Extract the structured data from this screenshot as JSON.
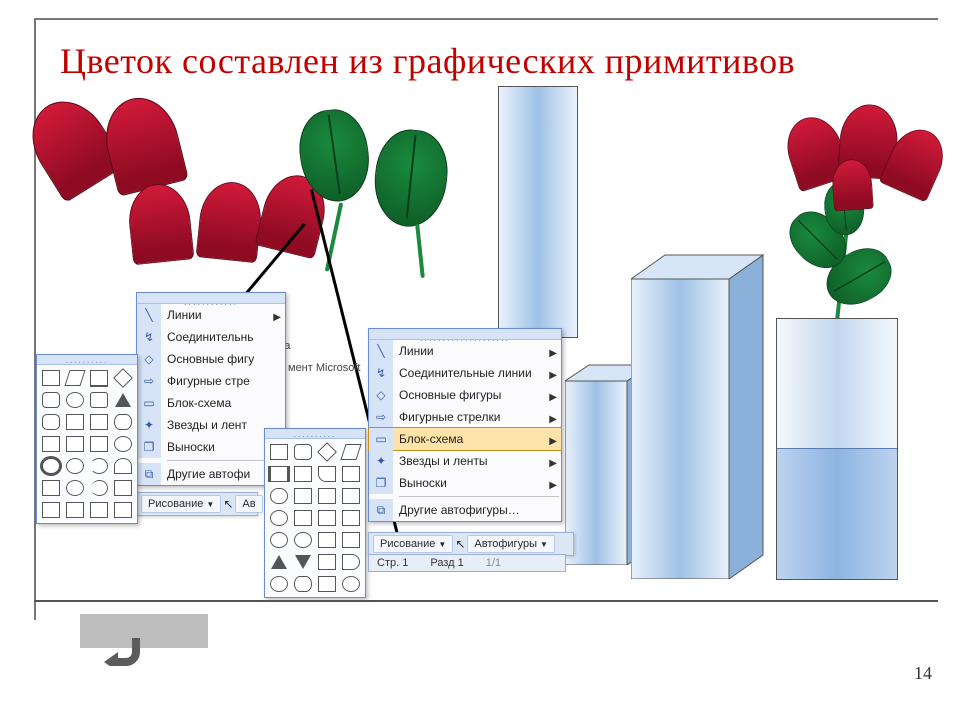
{
  "slide": {
    "title": "Цветок составлен из  графических примитивов",
    "page_number": "14"
  },
  "stray_text": {
    "dova": "дова",
    "ment": "мент Microsoft"
  },
  "menu1": {
    "items": [
      {
        "label": "Линии"
      },
      {
        "label": "Соединительнь"
      },
      {
        "label": "Основные фигу"
      },
      {
        "label": "Фигурные стре"
      },
      {
        "label": "Блок-схема"
      },
      {
        "label": "Звезды и лент"
      },
      {
        "label": "Выноски"
      },
      {
        "label": "Другие автофи"
      }
    ]
  },
  "menu2": {
    "items": [
      {
        "label": "Линии"
      },
      {
        "label": "Соединительные линии"
      },
      {
        "label": "Основные фигуры"
      },
      {
        "label": "Фигурные стрелки"
      },
      {
        "label": "Блок-схема",
        "highlight": true
      },
      {
        "label": "Звезды и ленты"
      },
      {
        "label": "Выноски"
      },
      {
        "label": "Другие автофигуры…"
      }
    ]
  },
  "toolbar1": {
    "draw": "Рисование",
    "af": "Ав"
  },
  "toolbar2": {
    "draw": "Рисование",
    "af": "Автофигуры"
  },
  "status": {
    "page": "Стр. 1",
    "section": "Разд 1",
    "pos": "1/1"
  }
}
